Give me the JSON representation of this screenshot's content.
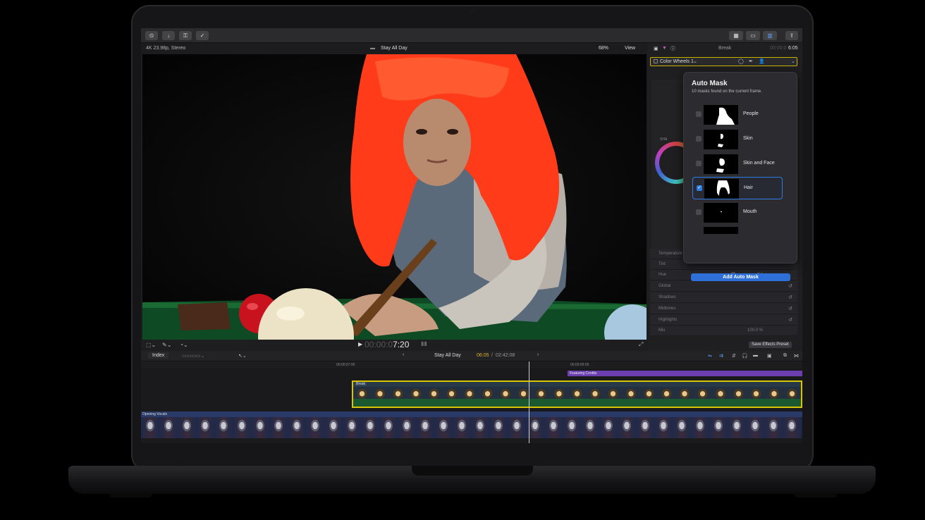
{
  "viewer": {
    "format": "4K 23.98p, Stereo",
    "project": "Stay All Day",
    "zoom": "68%",
    "view": "View",
    "timecode_dim": "00:00:0",
    "timecode_bright": "7:20"
  },
  "inspector": {
    "clip_name": "Break",
    "duration_dim": "00:00:0",
    "duration_bright": "6:05",
    "effect": "Color Wheels 1",
    "shadows_label": "SHA",
    "params": [
      {
        "label": "Temperature",
        "value": ""
      },
      {
        "label": "Tint",
        "value": ""
      },
      {
        "label": "Hue",
        "value": "0 °"
      },
      {
        "label": "Global",
        "value": ""
      },
      {
        "label": "Shadows",
        "value": ""
      },
      {
        "label": "Midtones",
        "value": ""
      },
      {
        "label": "Highlights",
        "value": ""
      },
      {
        "label": "Mix",
        "value": "100.0 %"
      }
    ],
    "save_preset": "Save Effects Preset"
  },
  "auto_mask": {
    "title": "Auto Mask",
    "subtitle": "10 masks found on the current frame.",
    "masks": [
      {
        "label": "People",
        "checked": false
      },
      {
        "label": "Skin",
        "checked": false
      },
      {
        "label": "Skin and Face",
        "checked": false
      },
      {
        "label": "Hair",
        "checked": true
      },
      {
        "label": "Mouth",
        "checked": false
      }
    ],
    "add_button": "Add Auto Mask"
  },
  "timeline": {
    "index": "Index",
    "project": "Stay All Day",
    "position": "06:05",
    "total": "02:42:08",
    "ruler_1": "00:00:07:00",
    "ruler_2": "00:00:09:05",
    "title_clip": "Featuring Credits",
    "video_clip": "Break",
    "audio_clip": "Opening Vocals"
  },
  "colors": {
    "accent": "#2f7de0",
    "selection": "#d8c400",
    "title_clip": "#6b3fb0",
    "hair_mask": "#ff3b1a"
  }
}
